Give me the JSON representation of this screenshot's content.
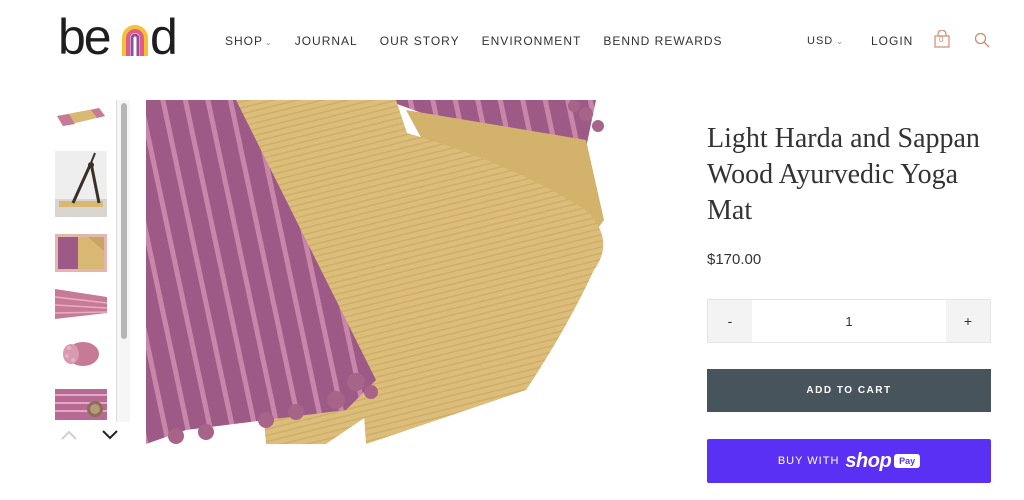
{
  "brand": {
    "logo_text": "bend",
    "colors": {
      "arch_yellow": "#f2c232",
      "arch_pink": "#e05a8c",
      "arch_purple": "#8a4e9a",
      "text": "#222222"
    }
  },
  "nav": {
    "items": [
      {
        "label": "SHOP",
        "has_dropdown": true
      },
      {
        "label": "JOURNAL"
      },
      {
        "label": "OUR STORY"
      },
      {
        "label": "ENVIRONMENT"
      },
      {
        "label": "BENND REWARDS"
      }
    ]
  },
  "header_right": {
    "currency": "USD",
    "login": "LOGIN",
    "cart_count": "0",
    "icons": [
      "shopping-bag-icon",
      "search-icon"
    ]
  },
  "gallery": {
    "thumbnail_count": 6,
    "active_index": 2,
    "colors": {
      "mauve": "#9e5a86",
      "sand": "#d9b873",
      "active_border": "#e4b7ae"
    }
  },
  "product": {
    "title": "Light Harda and Sappan Wood Ayurvedic Yoga Mat",
    "price": "$170.00",
    "quantity": "1",
    "minus_label": "-",
    "plus_label": "+"
  },
  "actions": {
    "add_to_cart": "ADD TO CART",
    "buy_with": "BUY WITH",
    "shop_word": "shop",
    "pay_word": "Pay",
    "colors": {
      "add_to_cart_bg": "#47545c",
      "shop_pay_bg": "#5a31f4"
    }
  }
}
